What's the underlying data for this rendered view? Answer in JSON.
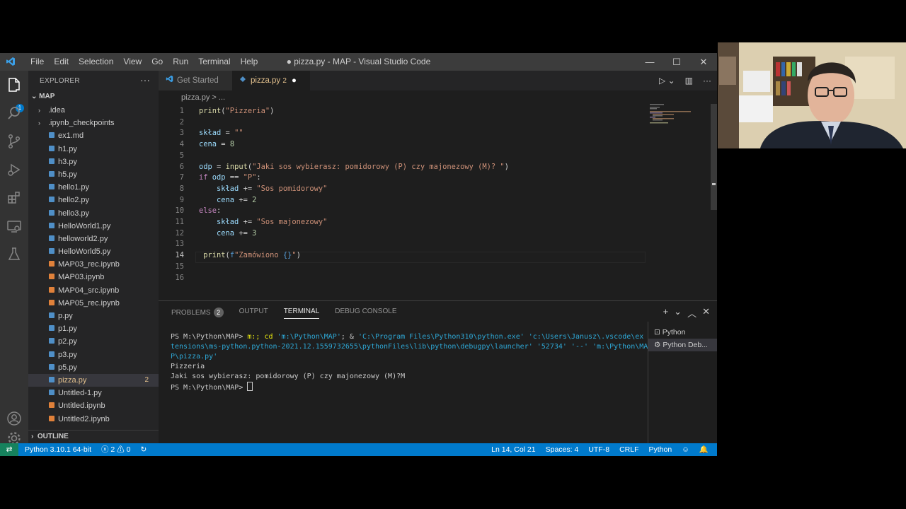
{
  "window": {
    "title": "● pizza.py - MAP - Visual Studio Code",
    "menu": [
      "File",
      "Edit",
      "Selection",
      "View",
      "Go",
      "Run",
      "Terminal",
      "Help"
    ],
    "controls": [
      "minimize-icon",
      "maximize-icon",
      "close-icon"
    ]
  },
  "activity": [
    "explorer-icon",
    "search-icon",
    "source-control-icon",
    "run-debug-icon",
    "extensions-icon",
    "remote-explorer-icon",
    "testing-icon",
    "account-icon",
    "settings-gear-icon"
  ],
  "activity_badge": "1",
  "sidebar": {
    "header": "EXPLORER",
    "more": "···",
    "folder": "MAP",
    "items": [
      {
        "name": ".idea",
        "kind": "folder"
      },
      {
        "name": ".ipynb_checkpoints",
        "kind": "folder"
      },
      {
        "name": "ex1.md",
        "kind": "md"
      },
      {
        "name": "h1.py",
        "kind": "py"
      },
      {
        "name": "h3.py",
        "kind": "py"
      },
      {
        "name": "h5.py",
        "kind": "py"
      },
      {
        "name": "hello1.py",
        "kind": "py"
      },
      {
        "name": "hello2.py",
        "kind": "py"
      },
      {
        "name": "hello3.py",
        "kind": "py"
      },
      {
        "name": "HelloWorld1.py",
        "kind": "py"
      },
      {
        "name": "helloworld2.py",
        "kind": "py"
      },
      {
        "name": "HelloWorld5.py",
        "kind": "py"
      },
      {
        "name": "MAP03_rec.ipynb",
        "kind": "nb"
      },
      {
        "name": "MAP03.ipynb",
        "kind": "nb"
      },
      {
        "name": "MAP04_src.ipynb",
        "kind": "nb"
      },
      {
        "name": "MAP05_rec.ipynb",
        "kind": "nb"
      },
      {
        "name": "p.py",
        "kind": "py"
      },
      {
        "name": "p1.py",
        "kind": "py"
      },
      {
        "name": "p2.py",
        "kind": "py"
      },
      {
        "name": "p3.py",
        "kind": "py"
      },
      {
        "name": "p5.py",
        "kind": "py"
      },
      {
        "name": "pizza.py",
        "kind": "py",
        "selected": true,
        "count": "2"
      },
      {
        "name": "Untitled-1.py",
        "kind": "py"
      },
      {
        "name": "Untitled.ipynb",
        "kind": "nb"
      },
      {
        "name": "Untitled2.ipynb",
        "kind": "nb"
      }
    ],
    "outline": "OUTLINE"
  },
  "tabs": [
    {
      "label": "Get Started"
    },
    {
      "label": "pizza.py",
      "count": "2",
      "modified": "●"
    }
  ],
  "breadcrumb": "pizza.py > ...",
  "editor": {
    "current_line": 14,
    "lines": [
      {
        "no": "1",
        "tokens": [
          [
            "f",
            "print"
          ],
          [
            "p",
            "("
          ],
          [
            "s",
            "\"Pizzeria\""
          ],
          [
            "p",
            ")"
          ]
        ]
      },
      {
        "no": "2",
        "tokens": []
      },
      {
        "no": "3",
        "tokens": [
          [
            "v",
            "skład"
          ],
          [
            "p",
            " = "
          ],
          [
            "s",
            "\"\""
          ]
        ]
      },
      {
        "no": "4",
        "tokens": [
          [
            "v",
            "cena"
          ],
          [
            "p",
            " = "
          ],
          [
            "n",
            "8"
          ]
        ]
      },
      {
        "no": "5",
        "tokens": []
      },
      {
        "no": "6",
        "tokens": [
          [
            "v",
            "odp"
          ],
          [
            "p",
            " = "
          ],
          [
            "f",
            "input"
          ],
          [
            "p",
            "("
          ],
          [
            "s",
            "\"Jaki sos wybierasz: pomidorowy (P) czy majonezowy (M)? \""
          ],
          [
            "p",
            ")"
          ]
        ]
      },
      {
        "no": "7",
        "tokens": [
          [
            "k",
            "if"
          ],
          [
            "p",
            " "
          ],
          [
            "v",
            "odp"
          ],
          [
            "p",
            " == "
          ],
          [
            "s",
            "\"P\""
          ],
          [
            "p",
            ":"
          ]
        ]
      },
      {
        "no": "8",
        "tokens": [
          [
            "p",
            "    "
          ],
          [
            "v",
            "skład"
          ],
          [
            "p",
            " += "
          ],
          [
            "s",
            "\"Sos pomidorowy\""
          ]
        ]
      },
      {
        "no": "9",
        "tokens": [
          [
            "p",
            "    "
          ],
          [
            "v",
            "cena"
          ],
          [
            "p",
            " += "
          ],
          [
            "n",
            "2"
          ]
        ]
      },
      {
        "no": "10",
        "tokens": [
          [
            "k",
            "else"
          ],
          [
            "p",
            ":"
          ]
        ]
      },
      {
        "no": "11",
        "tokens": [
          [
            "p",
            "    "
          ],
          [
            "v",
            "skład"
          ],
          [
            "p",
            " += "
          ],
          [
            "s",
            "\"Sos majonezowy\""
          ]
        ]
      },
      {
        "no": "12",
        "tokens": [
          [
            "p",
            "    "
          ],
          [
            "v",
            "cena"
          ],
          [
            "p",
            " += "
          ],
          [
            "n",
            "3"
          ]
        ]
      },
      {
        "no": "13",
        "tokens": []
      },
      {
        "no": "14",
        "tokens": [
          [
            "p",
            " "
          ],
          [
            "f",
            "print"
          ],
          [
            "p",
            "("
          ],
          [
            "b",
            "f"
          ],
          [
            "s",
            "\"Zamówiono "
          ],
          [
            "b",
            "{}"
          ],
          [
            "s",
            "\""
          ],
          [
            "p",
            ")"
          ]
        ]
      },
      {
        "no": "15",
        "tokens": []
      },
      {
        "no": "16",
        "tokens": []
      }
    ]
  },
  "panel": {
    "tabs": [
      {
        "label": "PROBLEMS",
        "badge": "2"
      },
      {
        "label": "OUTPUT"
      },
      {
        "label": "TERMINAL",
        "active": true
      },
      {
        "label": "DEBUG CONSOLE"
      }
    ],
    "actions": [
      "+",
      "⌄",
      "︿",
      "✕"
    ],
    "terminal": {
      "prompt1": "PS M:\\Python\\MAP> ",
      "cmd_a": "m:; cd ",
      "cmd_b": "'m:\\Python\\MAP'",
      "cmd_c": "; & ",
      "cmd_d": "'C:\\Program Files\\Python310\\python.exe' 'c:\\Users\\Janusz\\.vscode\\ex",
      "cmd_e": "tensions\\ms-python.python-2021.12.1559732655\\pythonFiles\\lib\\python\\debugpy\\launcher' '52734' '--' 'm:\\Python\\MA",
      "cmd_f": "P\\pizza.py'",
      "out1": "Pizzeria",
      "out2": "Jaki sos wybierasz: pomidorowy (P) czy majonezowy (M)?M",
      "prompt2": "PS M:\\Python\\MAP> "
    },
    "terminals": [
      {
        "label": "Python",
        "icon": "terminal-icon"
      },
      {
        "label": "Python Deb...",
        "icon": "debug-gear-icon",
        "selected": true
      }
    ]
  },
  "status": {
    "python": "Python 3.10.1 64-bit",
    "errors": "2",
    "warnings": "0",
    "position": "Ln 14, Col 21",
    "spaces": "Spaces: 4",
    "encoding": "UTF-8",
    "eol": "CRLF",
    "language": "Python"
  }
}
